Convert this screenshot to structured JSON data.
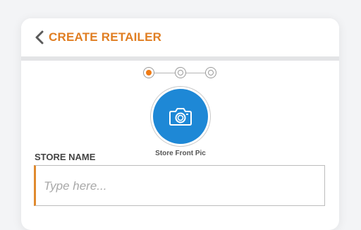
{
  "header": {
    "back_icon": "chevron-left-icon",
    "title": "CREATE RETAILER"
  },
  "stepper": {
    "steps": 3,
    "current_step": 1
  },
  "photo": {
    "icon": "camera-icon",
    "caption": "Store Front Pic",
    "color": "#1e88d6"
  },
  "store_name": {
    "label": "STORE NAME",
    "value": "",
    "placeholder": "Type here..."
  },
  "colors": {
    "accent": "#e07e22",
    "step_active": "#f07b14"
  }
}
